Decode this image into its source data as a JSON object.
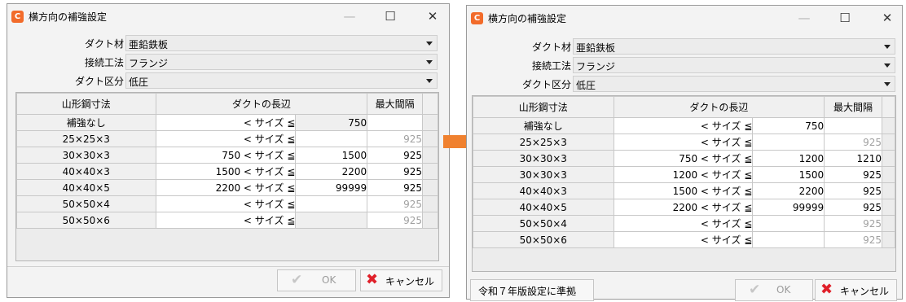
{
  "dialog_left": {
    "title": "横方向の補強設定",
    "app_icon": "C",
    "fields": [
      {
        "label": "ダクト材",
        "value": "亜鉛鉄板"
      },
      {
        "label": "接続工法",
        "value": "フランジ"
      },
      {
        "label": "ダクト区分",
        "value": "低圧"
      }
    ],
    "table": {
      "headers": [
        "山形鋼寸法",
        "ダクトの長辺",
        "最大間隔"
      ],
      "rows": [
        {
          "name": "補強なし",
          "range": "< サイズ ≦",
          "max": "750",
          "interval": "",
          "dim": false,
          "shade": true
        },
        {
          "name": "25×25×3",
          "range": "< サイズ ≦",
          "max": "",
          "interval": "925",
          "dim": true,
          "shade": false
        },
        {
          "name": "30×30×3",
          "range": "750  < サイズ ≦",
          "max": "1500",
          "interval": "925",
          "dim": false,
          "shade": false
        },
        {
          "name": "40×40×3",
          "range": "1500  < サイズ ≦",
          "max": "2200",
          "interval": "925",
          "dim": false,
          "shade": false
        },
        {
          "name": "40×40×5",
          "range": "2200  < サイズ ≦",
          "max": "99999",
          "interval": "925",
          "dim": false,
          "shade": false
        },
        {
          "name": "50×50×4",
          "range": "< サイズ ≦",
          "max": "",
          "interval": "925",
          "dim": true,
          "shade": false
        },
        {
          "name": "50×50×6",
          "range": "< サイズ ≦",
          "max": "",
          "interval": "925",
          "dim": true,
          "shade": true
        }
      ]
    },
    "buttons": {
      "ok": "OK",
      "cancel": "キャンセル"
    }
  },
  "dialog_right": {
    "title": "横方向の補強設定",
    "app_icon": "C",
    "fields": [
      {
        "label": "ダクト材",
        "value": "亜鉛鉄板"
      },
      {
        "label": "接続工法",
        "value": "フランジ"
      },
      {
        "label": "ダクト区分",
        "value": "低圧"
      }
    ],
    "table": {
      "headers": [
        "山形鋼寸法",
        "ダクトの長辺",
        "最大間隔"
      ],
      "rows": [
        {
          "name": "補強なし",
          "range": "< サイズ ≦",
          "max": "750",
          "interval": "",
          "dim": false,
          "shade": false
        },
        {
          "name": "25×25×3",
          "range": "< サイズ ≦",
          "max": "",
          "interval": "925",
          "dim": true,
          "shade": false
        },
        {
          "name": "30×30×3",
          "range": "750  < サイズ ≦",
          "max": "1200",
          "interval": "1210",
          "dim": false,
          "shade": false
        },
        {
          "name": "30×30×3",
          "range": "1200  < サイズ ≦",
          "max": "1500",
          "interval": "925",
          "dim": false,
          "shade": false
        },
        {
          "name": "40×40×3",
          "range": "1500  < サイズ ≦",
          "max": "2200",
          "interval": "925",
          "dim": false,
          "shade": false
        },
        {
          "name": "40×40×5",
          "range": "2200  < サイズ ≦",
          "max": "99999",
          "interval": "925",
          "dim": false,
          "shade": false
        },
        {
          "name": "50×50×4",
          "range": "< サイズ ≦",
          "max": "",
          "interval": "925",
          "dim": true,
          "shade": false
        },
        {
          "name": "50×50×6",
          "range": "< サイズ ≦",
          "max": "",
          "interval": "925",
          "dim": true,
          "shade": false
        }
      ]
    },
    "buttons": {
      "ok": "OK",
      "cancel": "キャンセル",
      "preset": "令和７年版設定に準拠"
    }
  },
  "arrow_color": "#f0812f"
}
